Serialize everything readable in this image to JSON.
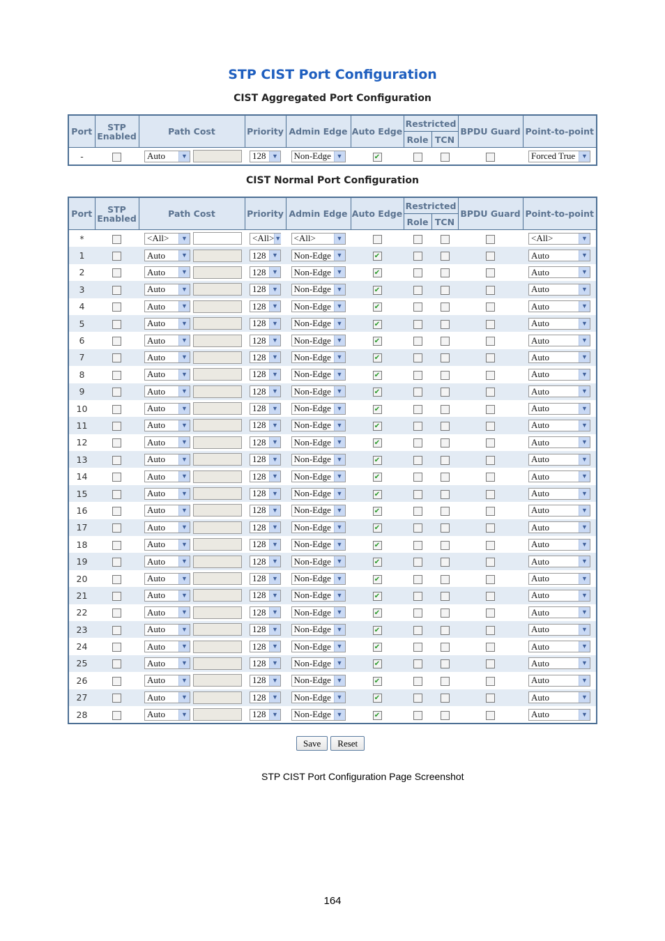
{
  "title": "STP CIST Port Configuration",
  "aggregated": {
    "heading": "CIST Aggregated Port Configuration",
    "row": {
      "port": "-",
      "stp": false,
      "path_cost": "Auto",
      "path_value": "",
      "priority": "128",
      "admin_edge": "Non-Edge",
      "auto_edge": true,
      "role": false,
      "tcn": false,
      "bpdu": false,
      "p2p": "Forced True"
    }
  },
  "normal": {
    "heading": "CIST Normal Port Configuration",
    "all_row": {
      "port": "*",
      "stp": false,
      "path_cost": "<All>",
      "path_value": "",
      "priority": "<All>",
      "admin_edge": "<All>",
      "auto_edge": false,
      "role": false,
      "tcn": false,
      "bpdu": false,
      "p2p": "<All>"
    },
    "ports": [
      "1",
      "2",
      "3",
      "4",
      "5",
      "6",
      "7",
      "8",
      "9",
      "10",
      "11",
      "12",
      "13",
      "14",
      "15",
      "16",
      "17",
      "18",
      "19",
      "20",
      "21",
      "22",
      "23",
      "24",
      "25",
      "26",
      "27",
      "28"
    ],
    "port_defaults": {
      "stp": false,
      "path_cost": "Auto",
      "path_value": "",
      "priority": "128",
      "admin_edge": "Non-Edge",
      "auto_edge": true,
      "role": false,
      "tcn": false,
      "bpdu": false,
      "p2p": "Auto"
    }
  },
  "headers": {
    "port": "Port",
    "stp": "STP Enabled",
    "path_cost": "Path Cost",
    "priority": "Priority",
    "admin_edge": "Admin Edge",
    "auto_edge": "Auto Edge",
    "restricted": "Restricted",
    "role": "Role",
    "tcn": "TCN",
    "bpdu": "BPDU Guard",
    "p2p": "Point-to-point"
  },
  "buttons": {
    "save": "Save",
    "reset": "Reset"
  },
  "caption": "STP CIST Port Configuration Page Screenshot",
  "page_number": "164",
  "colors": {
    "title": "#1f5fbf",
    "header_bg": "#dde7f3",
    "border": "#4c6f94",
    "odd_row": "#e3ebf4",
    "check": "#2a9a2a"
  }
}
